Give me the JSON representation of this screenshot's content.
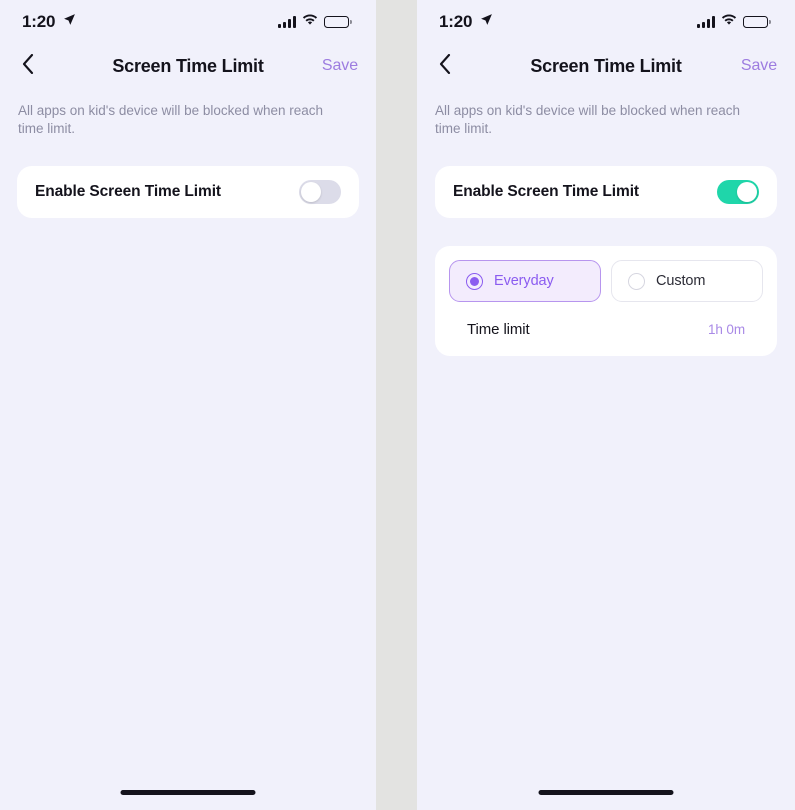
{
  "status_bar": {
    "time": "1:20",
    "location_icon": "location-arrow-icon",
    "cellular_icon": "cellular-bars-icon",
    "wifi_icon": "wifi-icon",
    "battery_icon": "battery-full-icon"
  },
  "nav": {
    "back_icon": "chevron-left-icon",
    "title": "Screen Time Limit",
    "save_label": "Save"
  },
  "description": "All apps on kid's device will be blocked when reach time limit.",
  "panels": [
    {
      "state": "disabled",
      "enable_row": {
        "label": "Enable Screen Time Limit",
        "toggle_state": "off"
      },
      "schedule_visible": false
    },
    {
      "state": "enabled",
      "enable_row": {
        "label": "Enable Screen Time Limit",
        "toggle_state": "on"
      },
      "schedule_visible": true,
      "schedule": {
        "options": [
          {
            "label": "Everyday",
            "selected": true
          },
          {
            "label": "Custom",
            "selected": false
          }
        ],
        "time_limit": {
          "label": "Time limit",
          "value": "1h 0m"
        }
      }
    }
  ],
  "colors": {
    "screen_background": "#f1f1fb",
    "gutter": "#e3e3e1",
    "card": "#ffffff",
    "accent_purple": "#8b5cf0",
    "save_purple": "#9d7ce0",
    "value_purple": "#a98ae6",
    "toggle_on": "#1fd6aa",
    "toggle_off": "#dcdce9",
    "text_primary": "#14131c",
    "text_muted": "#8d8da3"
  }
}
